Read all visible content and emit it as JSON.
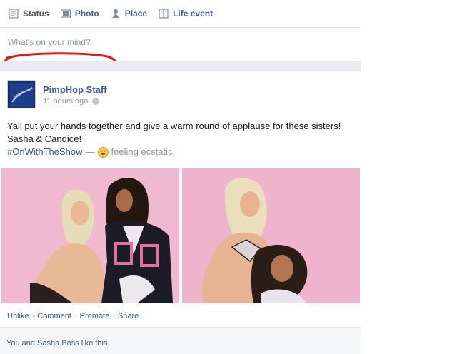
{
  "composer": {
    "tabs": [
      {
        "label": "Status",
        "icon": "status-icon"
      },
      {
        "label": "Photo",
        "icon": "photo-icon"
      },
      {
        "label": "Place",
        "icon": "place-icon"
      },
      {
        "label": "Life event",
        "icon": "life-event-icon"
      }
    ],
    "placeholder": "What's on your mind?",
    "highlight_color": "#e01b1b"
  },
  "post": {
    "author": "PimpHop Staff",
    "time": "11 hours ago",
    "text": "Yall put your hands together and give a warm round of applause for these sisters! Sasha & Candice!",
    "hashtag": "#OnWithTheShow",
    "dash": "—",
    "feeling": "feeling ecstatic.",
    "actions": [
      "Unlike",
      "Comment",
      "Promote",
      "Share"
    ],
    "likes": {
      "prefix": "You and ",
      "name": "Sasha Boss",
      "suffix": " like this."
    }
  },
  "colors": {
    "link": "#3b5998",
    "muted": "#9197a3",
    "photo_background": "#efb3cc"
  }
}
